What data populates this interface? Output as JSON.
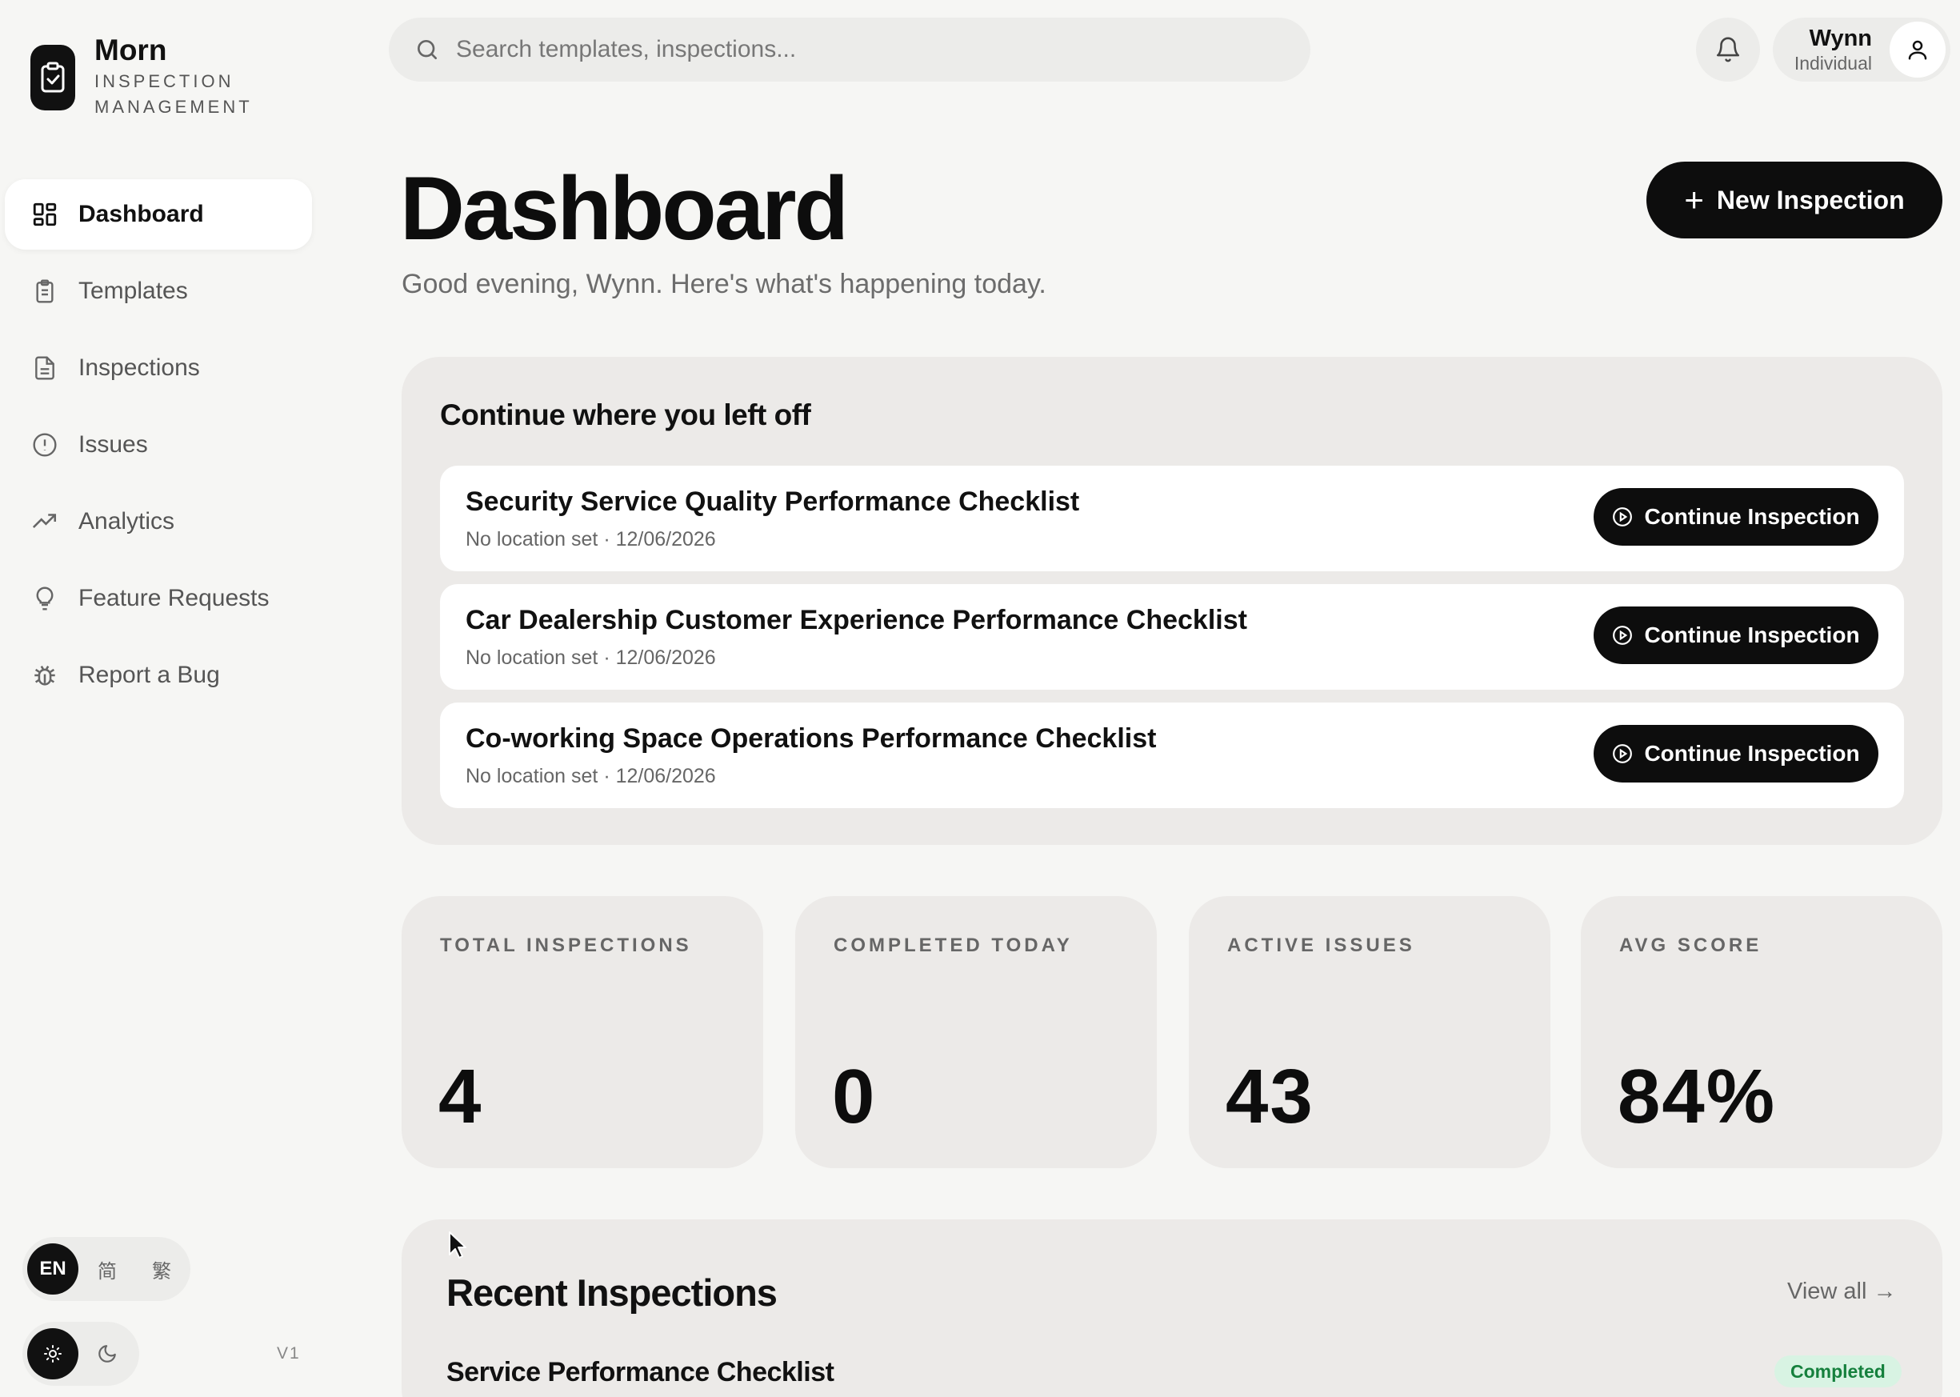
{
  "brand": {
    "name": "Morn",
    "subtitle_line1": "INSPECTION",
    "subtitle_line2": "MANAGEMENT"
  },
  "sidebar": {
    "items": [
      {
        "label": "Dashboard",
        "icon": "dashboard-icon",
        "active": true
      },
      {
        "label": "Templates",
        "icon": "clipboard-icon",
        "active": false
      },
      {
        "label": "Inspections",
        "icon": "document-icon",
        "active": false
      },
      {
        "label": "Issues",
        "icon": "alert-circle-icon",
        "active": false
      },
      {
        "label": "Analytics",
        "icon": "trend-up-icon",
        "active": false
      },
      {
        "label": "Feature Requests",
        "icon": "lightbulb-icon",
        "active": false
      },
      {
        "label": "Report a Bug",
        "icon": "bug-icon",
        "active": false
      }
    ],
    "languages": [
      {
        "label": "EN",
        "active": true
      },
      {
        "label": "简",
        "active": false
      },
      {
        "label": "繁",
        "active": false
      }
    ],
    "theme": {
      "light_icon": "sun-icon",
      "dark_icon": "moon-icon",
      "active": "light"
    },
    "version": "V1"
  },
  "topbar": {
    "search_placeholder": "Search templates, inspections...",
    "notification_icon": "bell-icon",
    "user": {
      "name": "Wynn",
      "role": "Individual",
      "avatar_icon": "user-icon"
    }
  },
  "header": {
    "title": "Dashboard",
    "greeting": "Good evening, Wynn. Here's what's happening today.",
    "new_button_label": "New Inspection"
  },
  "continue_section": {
    "title": "Continue where you left off",
    "items": [
      {
        "name": "Security Service Quality Performance Checklist",
        "meta": "No location set · 12/06/2026",
        "button_label": "Continue Inspection"
      },
      {
        "name": "Car Dealership Customer Experience Performance Checklist",
        "meta": "No location set · 12/06/2026",
        "button_label": "Continue Inspection"
      },
      {
        "name": "Co-working Space Operations Performance Checklist",
        "meta": "No location set · 12/06/2026",
        "button_label": "Continue Inspection"
      }
    ]
  },
  "stats": [
    {
      "label": "TOTAL INSPECTIONS",
      "value": "4"
    },
    {
      "label": "COMPLETED TODAY",
      "value": "0"
    },
    {
      "label": "ACTIVE ISSUES",
      "value": "43"
    },
    {
      "label": "AVG SCORE",
      "value": "84%"
    }
  ],
  "recent": {
    "title": "Recent Inspections",
    "view_all_label": "View all →",
    "rows": [
      {
        "name": "Service Performance Checklist",
        "status": "Completed"
      }
    ]
  },
  "colors": {
    "background": "#f6f6f4",
    "primary": "#0d0d0d",
    "panel": "#eceae8",
    "status_completed_bg": "#d8f3e3",
    "status_completed_text": "#15803d"
  }
}
